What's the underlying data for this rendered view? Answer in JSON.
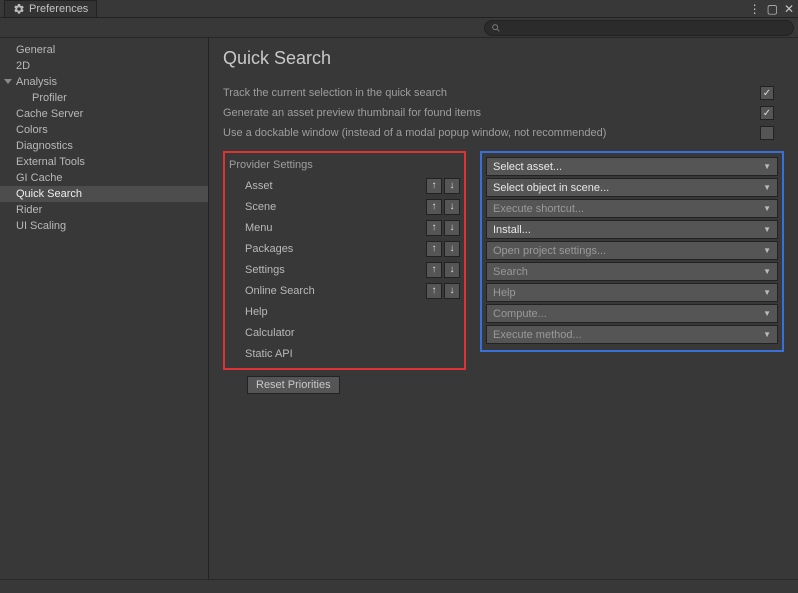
{
  "window": {
    "title": "Preferences"
  },
  "sidebar": {
    "items": [
      {
        "label": "General"
      },
      {
        "label": "2D"
      },
      {
        "label": "Analysis",
        "expandable": true
      },
      {
        "label": "Profiler",
        "child": true
      },
      {
        "label": "Cache Server"
      },
      {
        "label": "Colors"
      },
      {
        "label": "Diagnostics"
      },
      {
        "label": "External Tools"
      },
      {
        "label": "GI Cache"
      },
      {
        "label": "Quick Search",
        "selected": true
      },
      {
        "label": "Rider"
      },
      {
        "label": "UI Scaling"
      }
    ]
  },
  "page": {
    "title": "Quick Search",
    "options": [
      {
        "label": "Track the current selection in the quick search",
        "checked": true
      },
      {
        "label": "Generate an asset preview thumbnail for found items",
        "checked": true
      },
      {
        "label": "Use a dockable window (instead of a modal popup window, not recommended)",
        "checked": false
      }
    ],
    "provider_header": "Provider Settings",
    "providers": [
      {
        "name": "Asset",
        "arrows": true
      },
      {
        "name": "Scene",
        "arrows": true
      },
      {
        "name": "Menu",
        "arrows": true
      },
      {
        "name": "Packages",
        "arrows": true
      },
      {
        "name": "Settings",
        "arrows": true
      },
      {
        "name": "Online Search",
        "arrows": true
      },
      {
        "name": "Help",
        "arrows": false
      },
      {
        "name": "Calculator",
        "arrows": false
      },
      {
        "name": "Static API",
        "arrows": false
      }
    ],
    "actions": [
      {
        "label": "Select asset...",
        "bright": true
      },
      {
        "label": "Select object in scene...",
        "bright": true
      },
      {
        "label": "Execute shortcut...",
        "bright": false
      },
      {
        "label": "Install...",
        "bright": true
      },
      {
        "label": "Open project settings...",
        "bright": false
      },
      {
        "label": "Search",
        "bright": false
      },
      {
        "label": "Help",
        "bright": false
      },
      {
        "label": "Compute...",
        "bright": false
      },
      {
        "label": "Execute method...",
        "bright": false
      }
    ],
    "reset_label": "Reset Priorities"
  }
}
